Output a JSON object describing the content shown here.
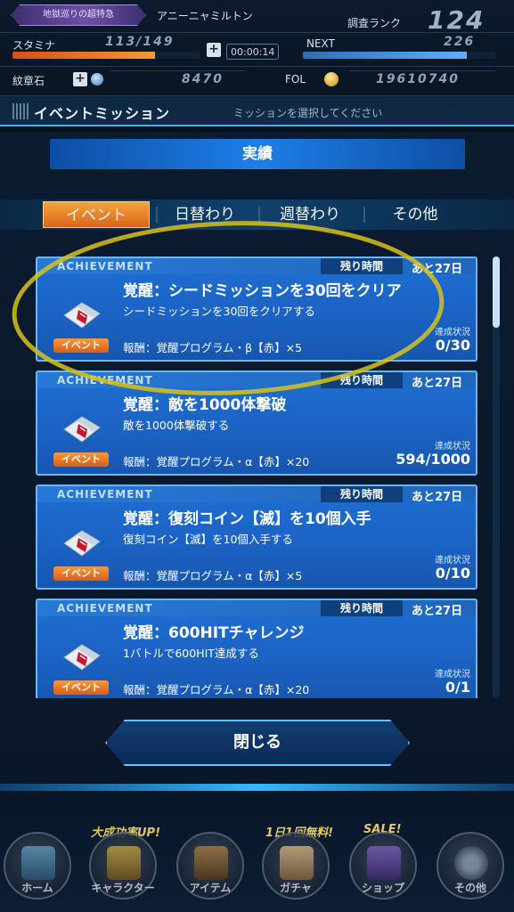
{
  "status": {
    "event_badge": "地獄巡りの超特急",
    "player_name": "アニーニャミルトン",
    "rank_label": "調査ランク",
    "rank_value": "124",
    "stamina_label": "スタミナ",
    "stamina_value": "113/149",
    "stamina_fraction": 0.76,
    "timer": "00:00:14",
    "next_label": "NEXT",
    "next_value": "226",
    "next_fraction": 0.85,
    "crest_label": "紋章石",
    "crest_value": "8470",
    "fol_label": "FOL",
    "fol_value": "19610740"
  },
  "screen_title": {
    "title": "イベントミッション",
    "hint": "ミッションを選択してください"
  },
  "dialog": {
    "header": "実績",
    "tabs": [
      {
        "label": "イベント",
        "active": true
      },
      {
        "label": "日替わり",
        "active": false
      },
      {
        "label": "週替わり",
        "active": false
      },
      {
        "label": "その他",
        "active": false
      }
    ],
    "close_label": "閉じる"
  },
  "missions": [
    {
      "header": "ACHIEVEMENT",
      "remain_label": "残り時間",
      "remain_value": "あと27日",
      "title": "覚醒：シードミッションを30回をクリア",
      "description": "シードミッションを30回をクリアする",
      "reward": "報酬：覚醒プログラム・β【赤】×5",
      "badge": "イベント",
      "progress_label": "達成状況",
      "progress": "0/30"
    },
    {
      "header": "ACHIEVEMENT",
      "remain_label": "残り時間",
      "remain_value": "あと27日",
      "title": "覚醒：敵を1000体撃破",
      "description": "敵を1000体撃破する",
      "reward": "報酬：覚醒プログラム・α【赤】×20",
      "badge": "イベント",
      "progress_label": "達成状況",
      "progress": "594/1000"
    },
    {
      "header": "ACHIEVEMENT",
      "remain_label": "残り時間",
      "remain_value": "あと27日",
      "title": "覚醒：復刻コイン【滅】を10個入手",
      "description": "復刻コイン【滅】を10個入手する",
      "reward": "報酬：覚醒プログラム・α【赤】×5",
      "badge": "イベント",
      "progress_label": "達成状況",
      "progress": "0/10"
    },
    {
      "header": "ACHIEVEMENT",
      "remain_label": "残り時間",
      "remain_value": "あと27日",
      "title": "覚醒：600HITチャレンジ",
      "description": "1バトルで600HIT達成する",
      "reward": "報酬：覚醒プログラム・α【赤】×20",
      "badge": "イベント",
      "progress_label": "達成状況",
      "progress": "0/1"
    }
  ],
  "nav": {
    "promo_character": "大成功率UP!",
    "promo_gacha": "1日1回無料!",
    "promo_shop": "SALE!",
    "items": [
      {
        "label": "ホーム",
        "icon": "home-icon"
      },
      {
        "label": "キャラクター",
        "icon": "character-icon"
      },
      {
        "label": "アイテム",
        "icon": "item-bag-icon"
      },
      {
        "label": "ガチャ",
        "icon": "gacha-icon"
      },
      {
        "label": "ショップ",
        "icon": "shop-icon"
      },
      {
        "label": "その他",
        "icon": "gear-icon"
      }
    ]
  },
  "colors": {
    "highlight_circle": "#d8c21a",
    "accent": "#38b7f0",
    "active_tab": "#f08a2c"
  }
}
